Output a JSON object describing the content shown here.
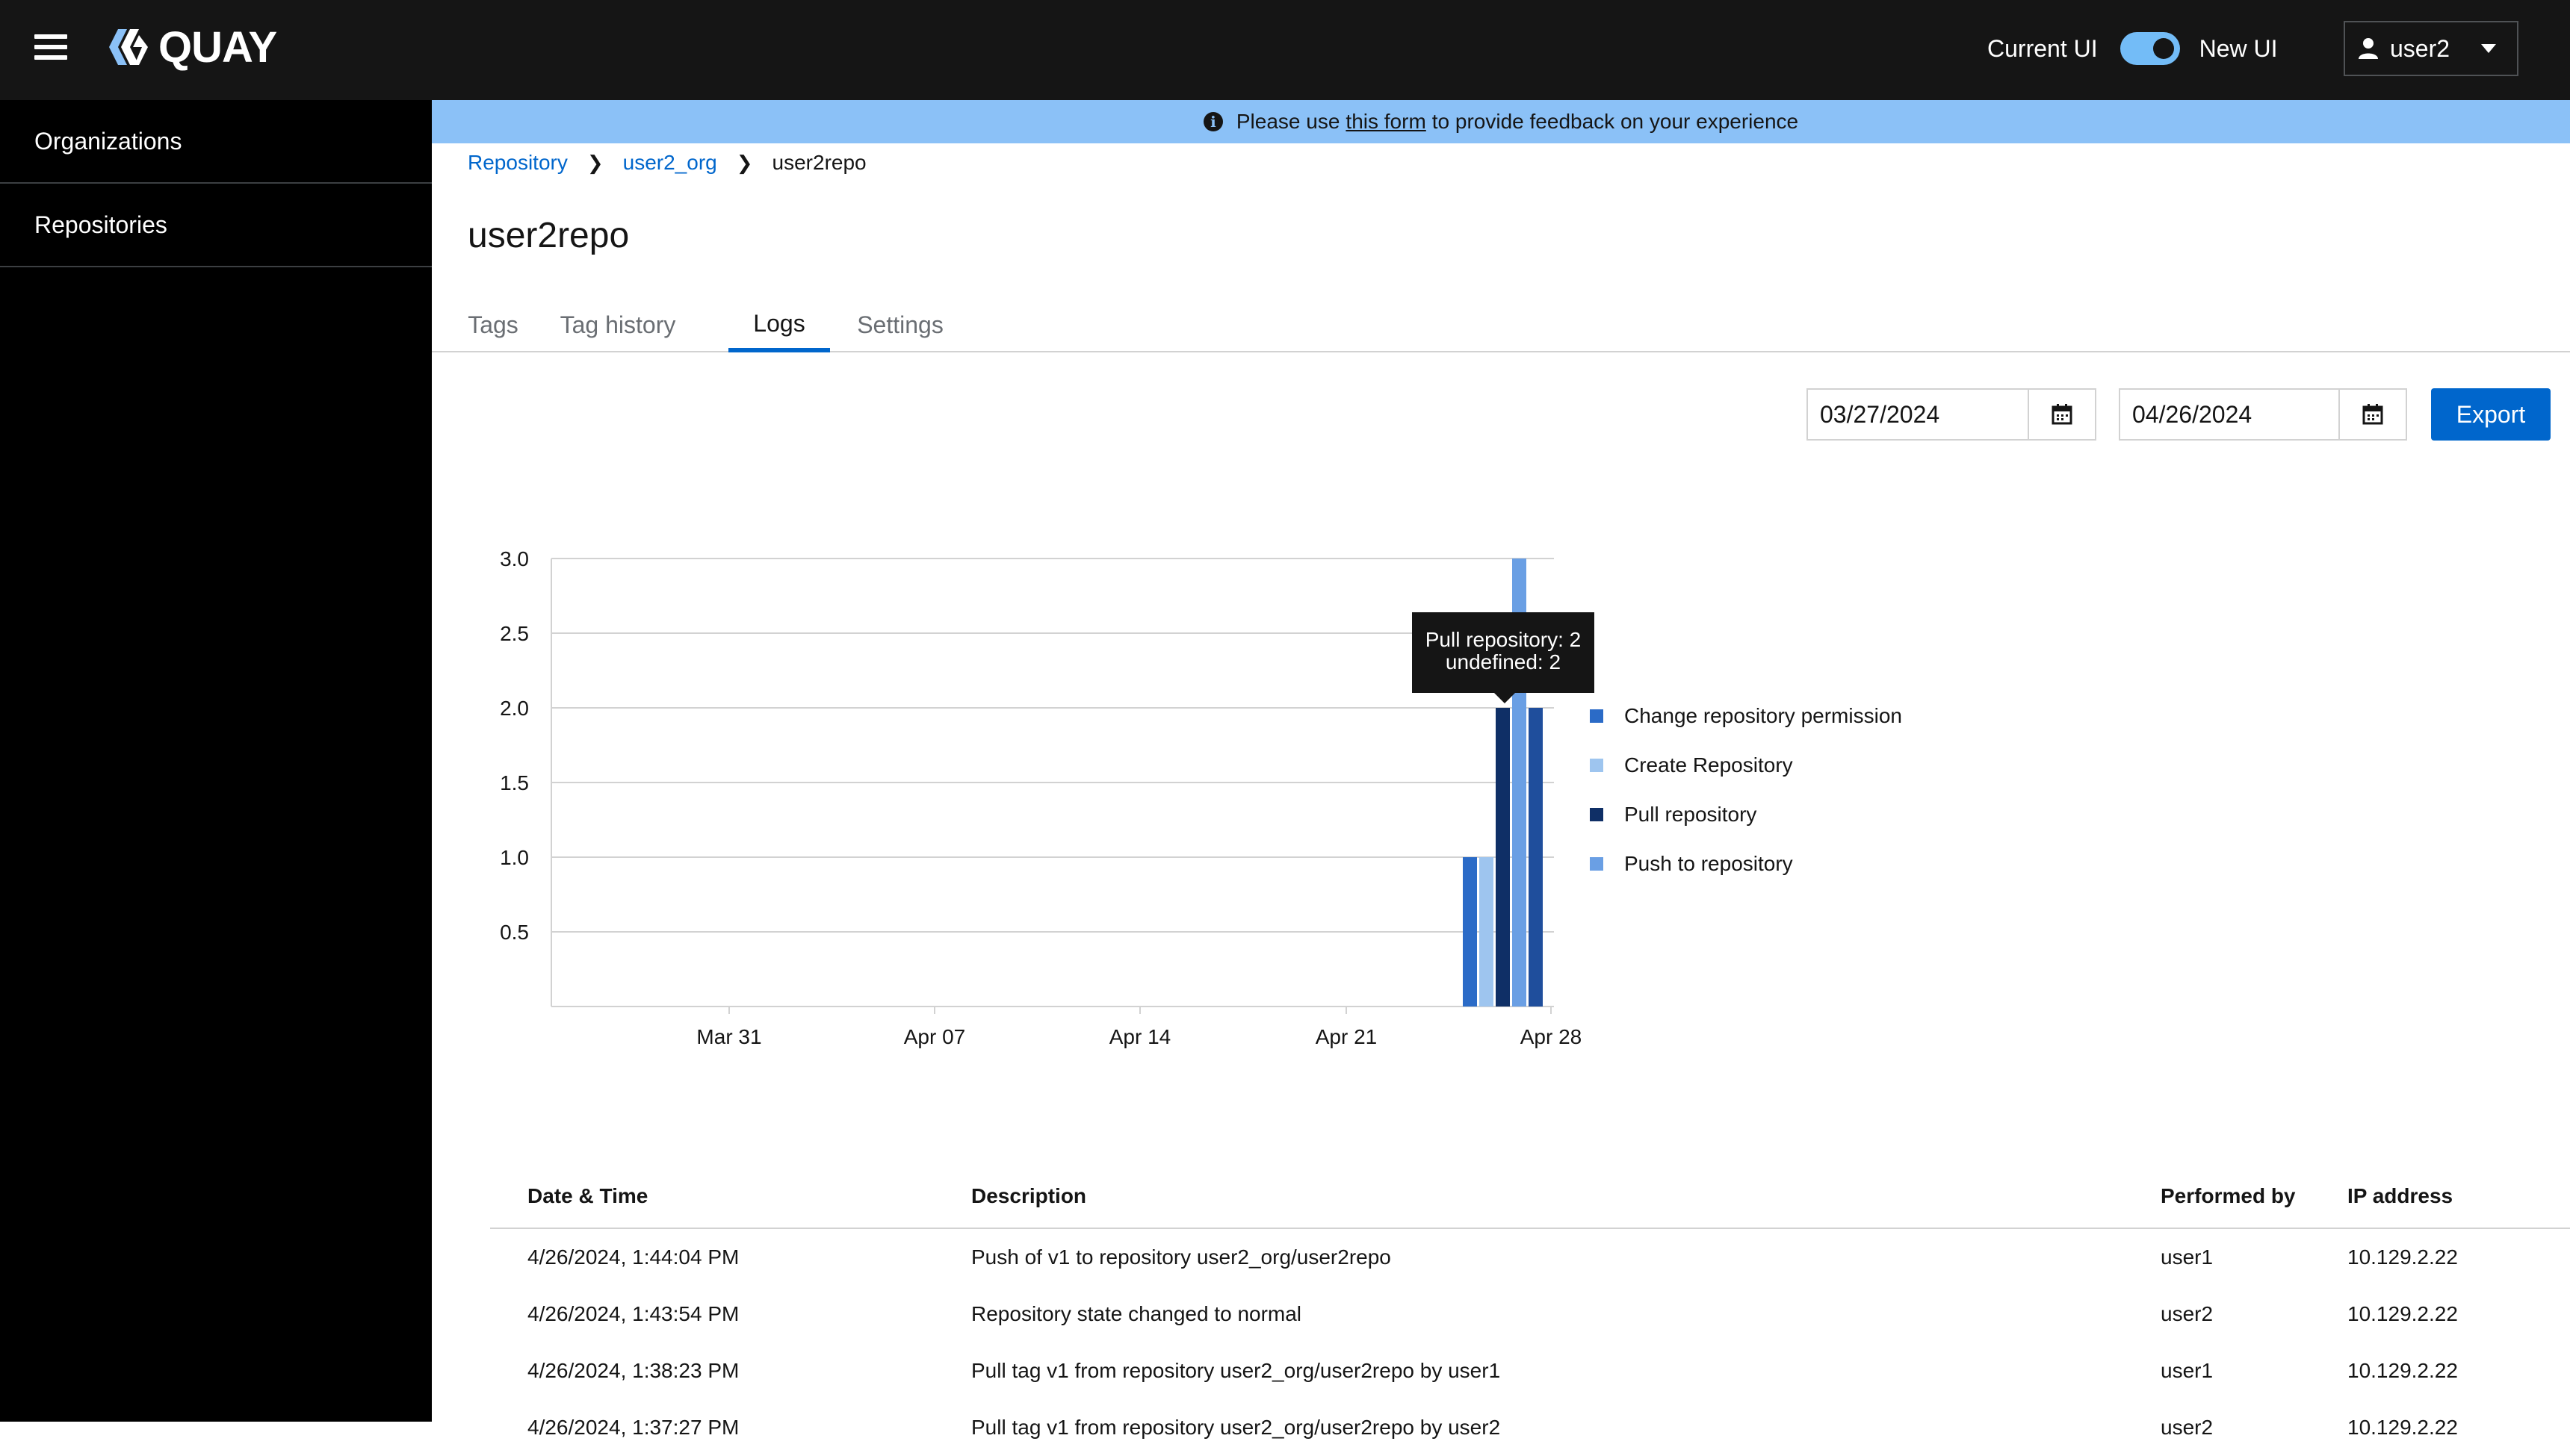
{
  "app": {
    "logo_text": "QUAY"
  },
  "masthead": {
    "current_ui_label": "Current UI",
    "new_ui_label": "New UI",
    "username": "user2"
  },
  "sidebar": {
    "items": [
      {
        "label": "Organizations"
      },
      {
        "label": "Repositories"
      }
    ]
  },
  "banner": {
    "prefix": "Please use",
    "link": "this form",
    "suffix": "to provide feedback on your experience"
  },
  "breadcrumb": [
    "Repository",
    "user2_org",
    "user2repo"
  ],
  "page_title": "user2repo",
  "tabs": [
    {
      "label": "Tags"
    },
    {
      "label": "Tag history"
    },
    {
      "label": "Logs",
      "active": true
    },
    {
      "label": "Settings"
    }
  ],
  "filters": {
    "start_date": "03/27/2024",
    "end_date": "04/26/2024",
    "export_label": "Export"
  },
  "chart_data": {
    "type": "bar",
    "x_ticks": [
      "Mar 31",
      "Apr 07",
      "Apr 14",
      "Apr 21",
      "Apr 28"
    ],
    "y_ticks": [
      "0.5",
      "1.0",
      "1.5",
      "2.0",
      "2.5",
      "3.0"
    ],
    "ylim": [
      0,
      3
    ],
    "grid": true,
    "legend_position": "right",
    "series": [
      {
        "name": "Change repository permission",
        "color": "#2b6bc7",
        "x": "Apr 26",
        "value": 1
      },
      {
        "name": "Create Repository",
        "color": "#9ec5ef",
        "x": "Apr 26",
        "value": 1
      },
      {
        "name": "Pull repository",
        "color": "#0f2f66",
        "x": "Apr 26",
        "value": 2
      },
      {
        "name": "Push to repository",
        "color": "#6a9fe4",
        "x": "Apr 26",
        "value": 3
      },
      {
        "name": "",
        "color": "#1f4e9c",
        "x": "Apr 26",
        "value": 2
      }
    ],
    "tooltip": [
      "Pull repository: 2",
      "undefined: 2"
    ]
  },
  "table": {
    "headers": [
      "Date & Time",
      "Description",
      "Performed by",
      "IP address"
    ],
    "rows": [
      [
        "4/26/2024, 1:44:04 PM",
        "Push of v1 to repository user2_org/user2repo",
        "user1",
        "10.129.2.22"
      ],
      [
        "4/26/2024, 1:43:54 PM",
        "Repository state changed to normal",
        "user2",
        "10.129.2.22"
      ],
      [
        "4/26/2024, 1:38:23 PM",
        "Pull tag v1 from repository user2_org/user2repo by user1",
        "user1",
        "10.129.2.22"
      ],
      [
        "4/26/2024, 1:37:27 PM",
        "Pull tag v1 from repository user2_org/user2repo by user2",
        "user2",
        "10.129.2.22"
      ]
    ]
  }
}
